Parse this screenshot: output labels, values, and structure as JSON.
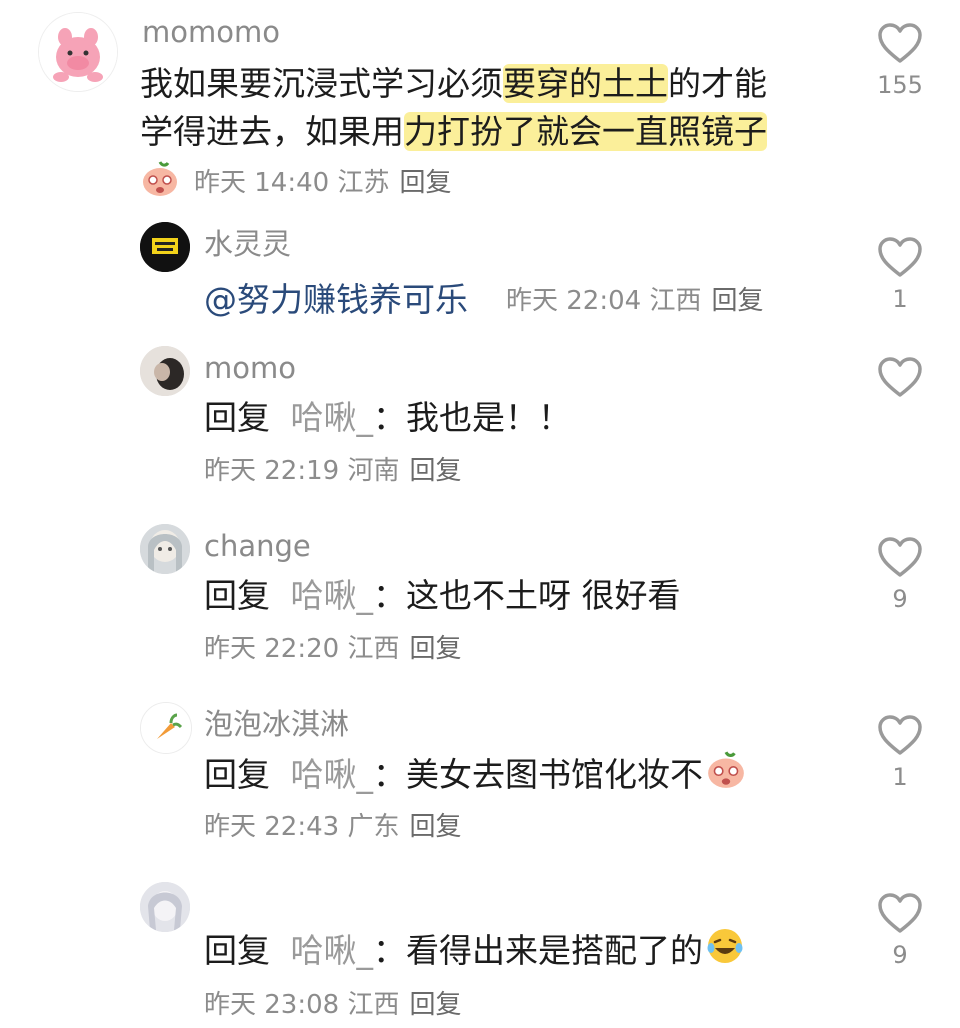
{
  "comments": [
    {
      "username": "momomo",
      "line1_pre": "我如果要沉浸式学习必须",
      "line1_hl": "要穿的土土",
      "line1_post": "的才能",
      "line2_pre": "学得进去，如果用",
      "line2_hl": "力打扮了就会一直照镜子",
      "time": "昨天 14:40",
      "location": "江苏",
      "reply": "回复",
      "likes": "155"
    },
    {
      "username": "水灵灵",
      "mention": "@努力赚钱养可乐",
      "time": "昨天 22:04",
      "location": "江西",
      "reply": "回复",
      "likes": "1"
    },
    {
      "username": "momo",
      "reply_word": "回复",
      "target": "哈啾_",
      "content": "：我也是！！",
      "time": "昨天 22:19",
      "location": "河南",
      "reply": "回复",
      "likes": ""
    },
    {
      "username": "change",
      "reply_word": "回复",
      "target": "哈啾_",
      "content": "：这也不土呀 很好看",
      "time": "昨天 22:20",
      "location": "江西",
      "reply": "回复",
      "likes": "9"
    },
    {
      "username": "泡泡冰淇淋",
      "reply_word": "回复",
      "target": "哈啾_",
      "content": "：美女去图书馆化妆不",
      "time": "昨天 22:43",
      "location": "广东",
      "reply": "回复",
      "likes": "1"
    },
    {
      "username": "",
      "reply_word": "回复",
      "target": "哈啾_",
      "content": "：看得出来是搭配了的",
      "time": "昨天 23:08",
      "location": "江西",
      "reply": "回复",
      "likes": "9"
    }
  ],
  "icons": {
    "like": "heart-outline-icon",
    "sticker": "peach-face-sticker",
    "laugh": "laughing-tears-emoji"
  },
  "colors": {
    "highlight": "#fbef9a",
    "username": "#8a8a8a",
    "meta": "#8c8c8c",
    "mention": "#2a4a7a"
  }
}
